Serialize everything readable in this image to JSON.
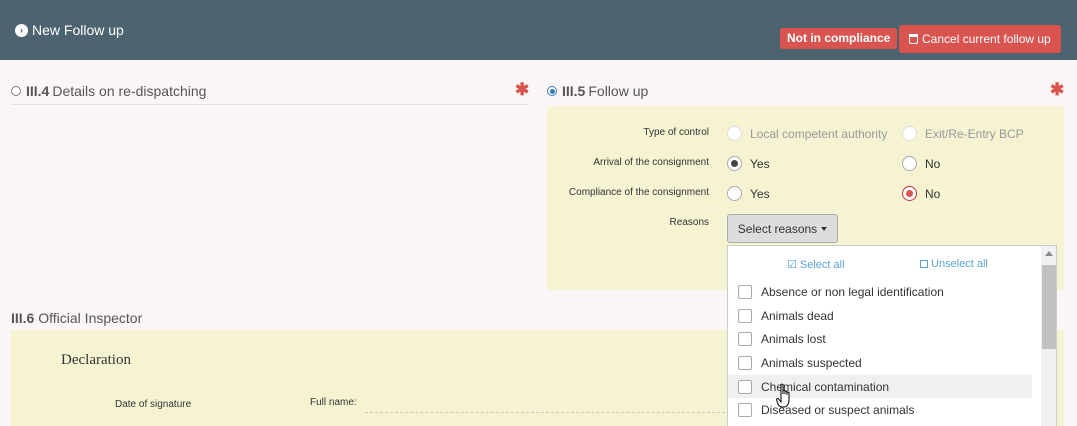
{
  "header": {
    "title": "New Follow up",
    "badge": "Not in compliance",
    "cancel_label": "Cancel current follow up"
  },
  "section_34": {
    "number": "III.4",
    "title": "Details on re-dispatching"
  },
  "section_35": {
    "number": "III.5",
    "title": "Follow up",
    "type_of_control": {
      "label": "Type of control",
      "options": [
        "Local competent authority",
        "Exit/Re-Entry BCP"
      ]
    },
    "arrival": {
      "label": "Arrival of the consignment",
      "options": [
        "Yes",
        "No"
      ],
      "selected": "Yes"
    },
    "compliance": {
      "label": "Compliance of the consignment",
      "options": [
        "Yes",
        "No"
      ],
      "selected": "No"
    },
    "reasons": {
      "label": "Reasons",
      "button": "Select reasons"
    }
  },
  "dropdown": {
    "select_all": "Select all",
    "unselect_all": "Unselect all",
    "items": [
      "Absence or non legal identification",
      "Animals dead",
      "Animals lost",
      "Animals suspected",
      "Chemical contamination",
      "Diseased or suspect animals"
    ]
  },
  "section_36": {
    "number": "III.6",
    "title": "Official Inspector",
    "declaration": "Declaration",
    "date_label": "Date of signature",
    "fullname_label": "Full name:"
  },
  "colors": {
    "header": "#4d6370",
    "danger": "#d9534f",
    "panel": "#f6f3d2",
    "link": "#5ba4d6"
  },
  "icons": [
    "chevron-circle-right-icon",
    "trash-icon",
    "asterisk-icon",
    "check-square-icon",
    "square-icon",
    "hand-pointer-icon"
  ]
}
